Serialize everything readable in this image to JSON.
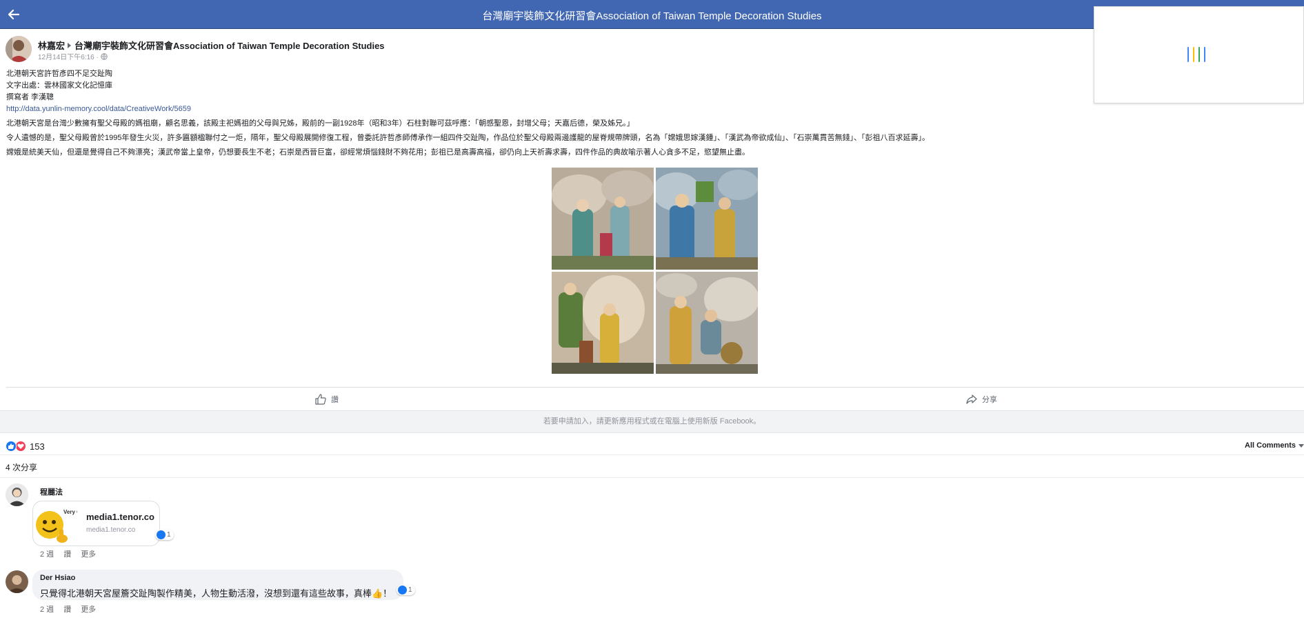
{
  "header": {
    "title": "台灣廟宇裝飾文化研習會Association of Taiwan Temple Decoration Studies",
    "back_icon": "arrow-left-icon",
    "background": "#4267b2"
  },
  "post": {
    "author": "林嘉宏",
    "group": "台灣廟宇裝飾文化研習會Association of Taiwan Temple Decoration Studies",
    "timestamp": "12月14日下午6:16",
    "separator": "·",
    "privacy_icon": "globe-icon",
    "lines": [
      "北港朝天宮許哲彥四不足交趾陶",
      "文字出處：雲林國家文化記憶庫",
      "撰寫者 李漢聰"
    ],
    "link": "http://data.yunlin-memory.cool/data/CreativeWork/5659",
    "paragraphs": [
      "北港朝天宮是台灣少數擁有聖父母殿的媽祖廟，顧名思義，該殿主祀媽祖的父母與兄姊，殿前的一副1928年（昭和3年）石柱對聯可茲呼應：「朝感聖恩，封增父母；天嘉后德，榮及姊兄。」",
      "令人遺憾的是，聖父母殿曾於1995年發生火災，許多匾額楹聯付之一炬，隔年，聖父母殿展開修復工程，曾委託許哲彥師傅承作一組四件交趾陶，作品位於聖父母殿兩邊護龍的屋脊規帶牌頭，名為「嫦娥思嫁漢鍾」、「漢武為帝欲成仙」、「石崇萬貫苦無錢」、「彭祖八百求延壽」。",
      "嫦娥是統美天仙，但還是覺得自己不夠漂亮；漢武帝當上皇帝，仍想要長生不老；石崇是西晉巨富，卻經常煩惱錢財不夠花用；彭祖已是高壽高福，卻仍向上天祈壽求壽，四件作品的典故喻示著人心貪多不足，慾望無止盡。"
    ],
    "photos": [
      "photo-1",
      "photo-2",
      "photo-3",
      "photo-4"
    ],
    "actions": {
      "like_label": "讚",
      "like_icon": "thumbs-up-icon",
      "share_label": "分享",
      "share_icon": "share-arrow-icon"
    }
  },
  "banner": {
    "text": "若要申請加入，請更新應用程式或在電腦上使用新版 Facebook。"
  },
  "stats": {
    "reaction_count": "153",
    "reaction_icons": [
      "like-reaction-icon",
      "love-reaction-icon"
    ],
    "sort_label": "All Comments",
    "shares": "4 次分享"
  },
  "comments": [
    {
      "name": "程麗法",
      "attachment": {
        "title": "media1.tenor.co",
        "domain": "media1.tenor.co",
        "gif_text": "Very Good"
      },
      "reaction_count": "1",
      "time": "2 週",
      "like_label": "讚",
      "more_label": "更多"
    },
    {
      "name": "Der Hsiao",
      "text": "只覺得北港朝天宮屋簷交趾陶製作精美，人物生動活潑，沒想到還有這些故事，真棒👍！",
      "reaction_count": "1",
      "time": "2 週",
      "like_label": "讚",
      "more_label": "更多"
    }
  ],
  "colors": {
    "brand_blue": "#4267b2",
    "link": "#385898",
    "like_blue": "#1877f2",
    "love_red": "#f33e58",
    "meta_gray": "#90949c"
  }
}
